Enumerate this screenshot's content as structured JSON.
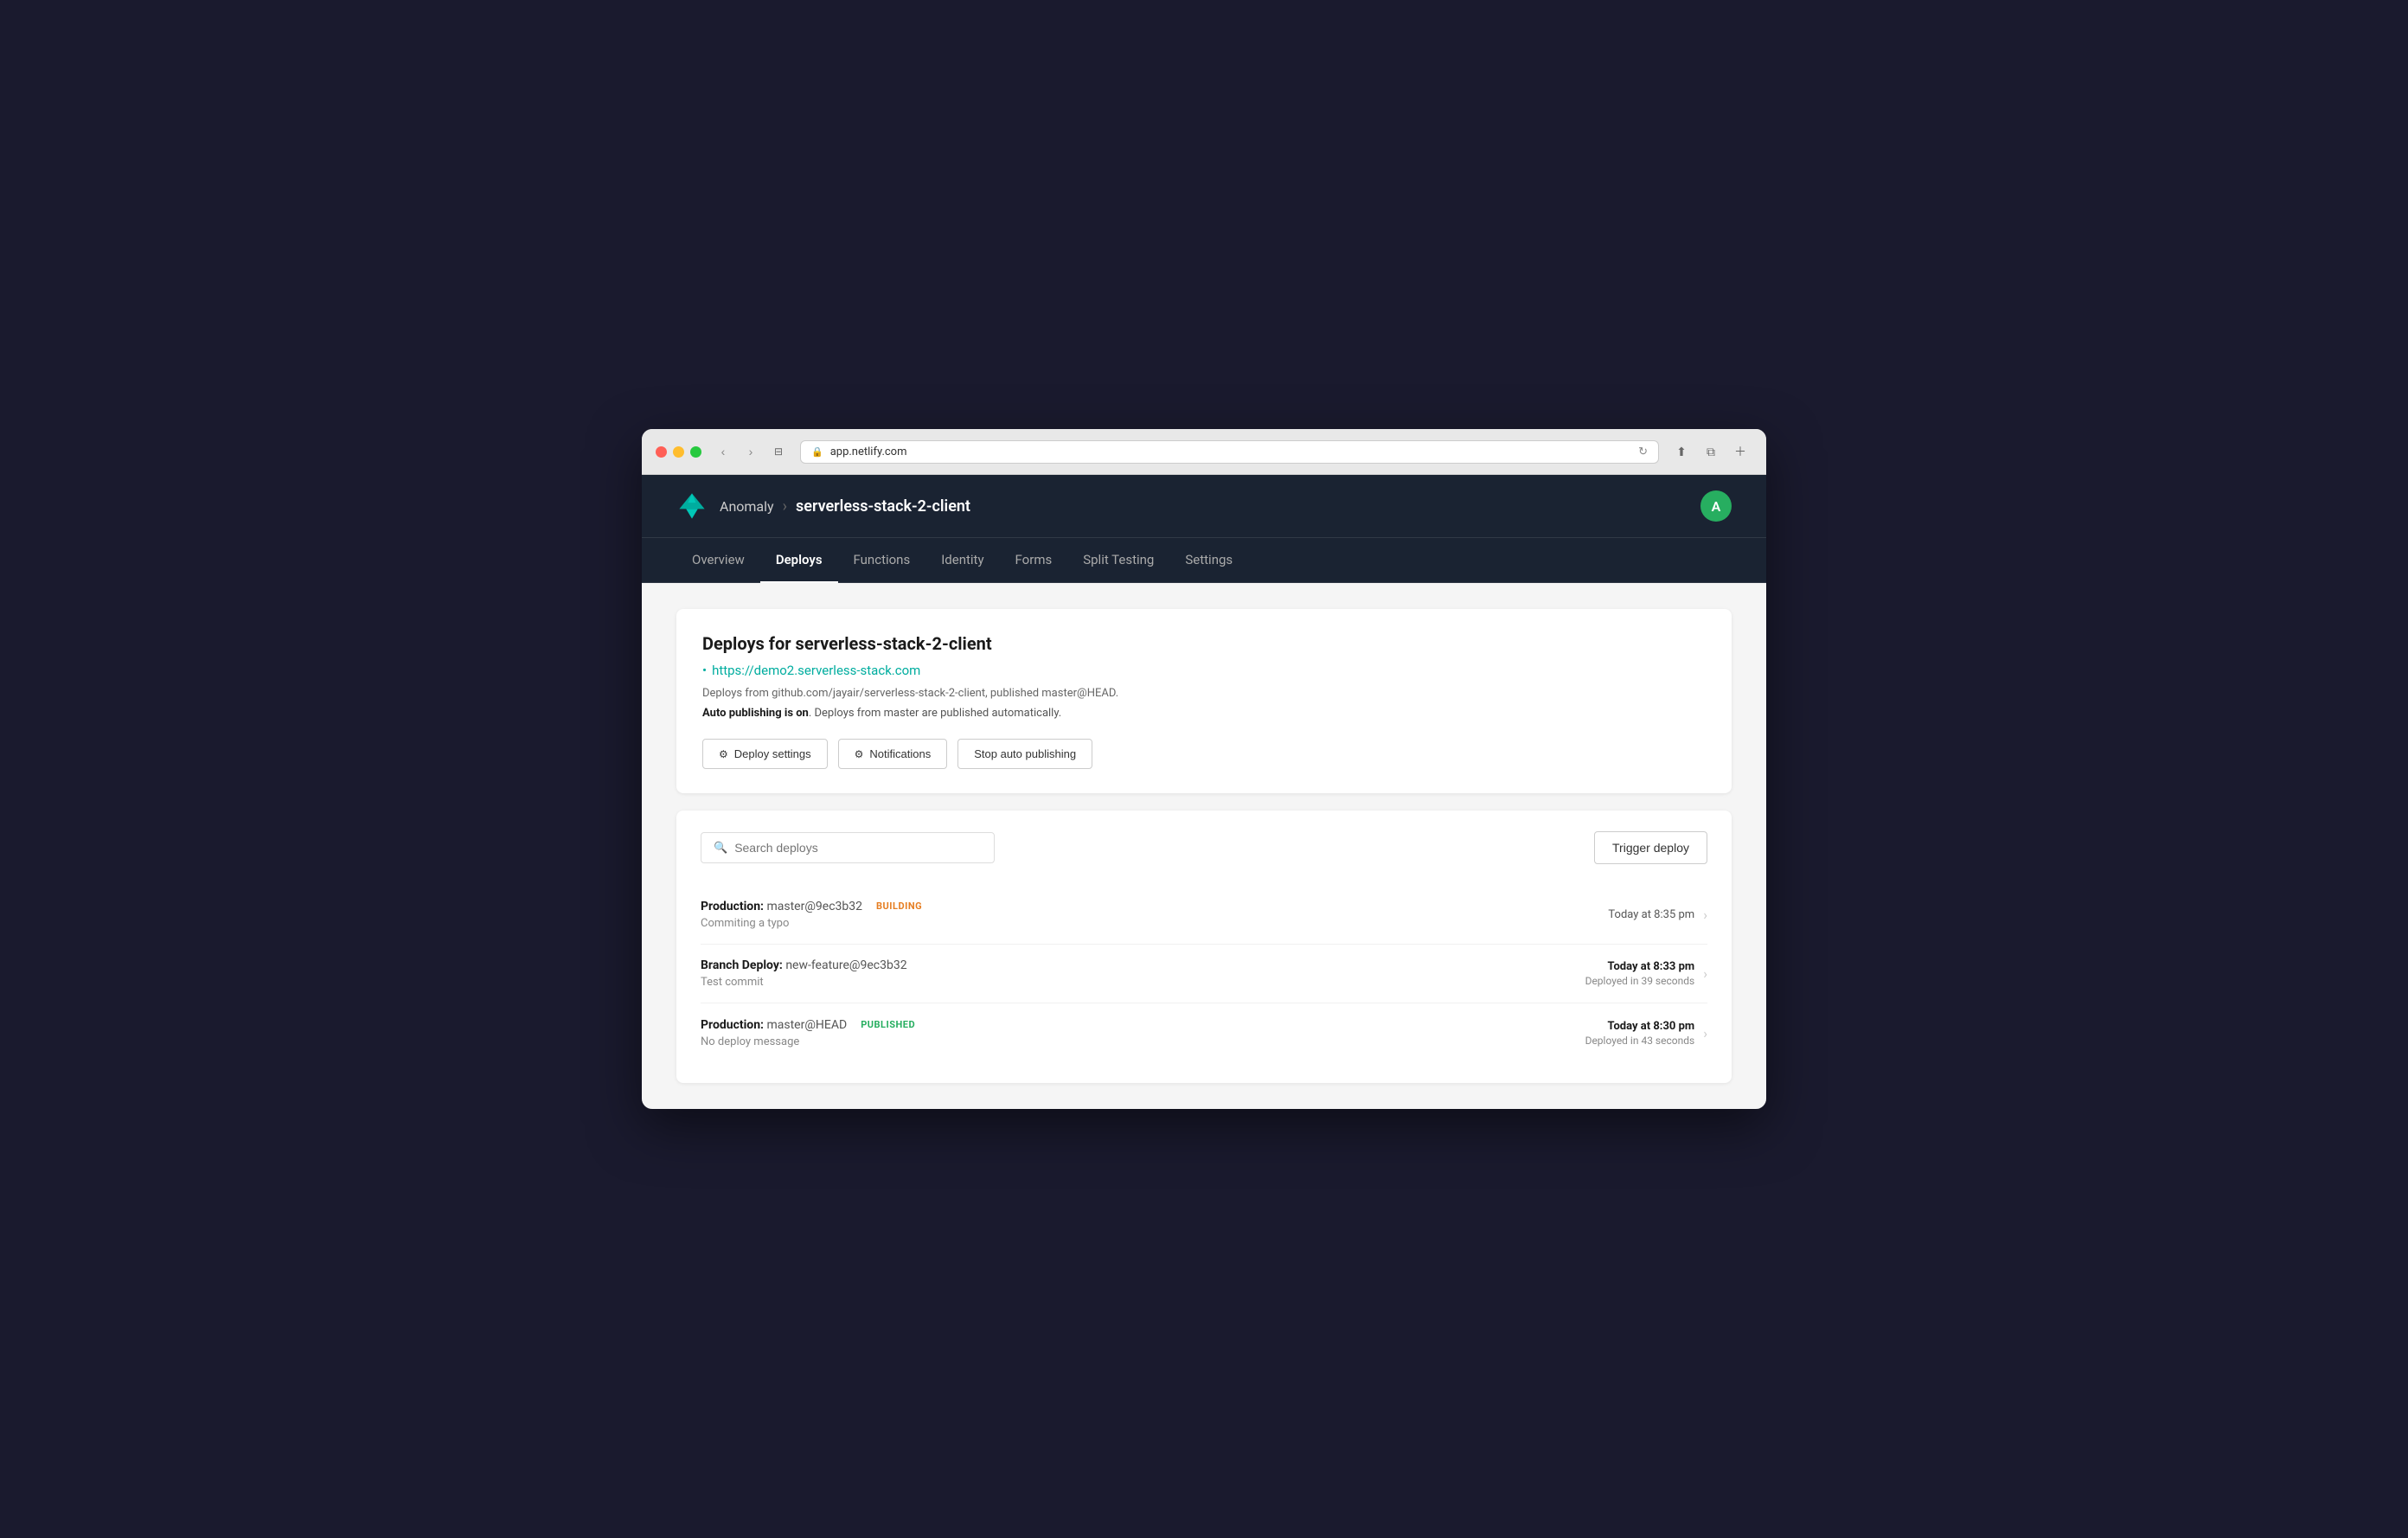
{
  "browser": {
    "url": "app.netlify.com",
    "back_label": "‹",
    "forward_label": "›"
  },
  "header": {
    "team_name": "Anomaly",
    "separator": "›",
    "site_name": "serverless-stack-2-client",
    "avatar_letter": "A"
  },
  "nav": {
    "items": [
      {
        "label": "Overview",
        "active": false
      },
      {
        "label": "Deploys",
        "active": true
      },
      {
        "label": "Functions",
        "active": false
      },
      {
        "label": "Identity",
        "active": false
      },
      {
        "label": "Forms",
        "active": false
      },
      {
        "label": "Split Testing",
        "active": false
      },
      {
        "label": "Settings",
        "active": false
      }
    ]
  },
  "deploys_card": {
    "title": "Deploys for serverless-stack-2-client",
    "site_url": "https://demo2.serverless-stack.com",
    "source_text": "Deploys from github.com/jayair/serverless-stack-2-client, published master@HEAD.",
    "auto_publish_label_bold": "Auto publishing is on",
    "auto_publish_label_rest": ". Deploys from master are published automatically.",
    "btn_deploy_settings": "Deploy settings",
    "btn_notifications": "Notifications",
    "btn_stop_auto": "Stop auto publishing"
  },
  "search": {
    "placeholder": "Search deploys",
    "trigger_btn": "Trigger deploy"
  },
  "deploys": [
    {
      "type_label": "Production:",
      "ref": "master@9ec3b32",
      "badge": "BUILDING",
      "badge_type": "building",
      "message": "Commiting a typo",
      "time": "Today at 8:35 pm",
      "time_bold": false,
      "duration": ""
    },
    {
      "type_label": "Branch Deploy:",
      "ref": "new-feature@9ec3b32",
      "badge": "",
      "badge_type": "",
      "message": "Test commit",
      "time": "Today at 8:33 pm",
      "time_bold": true,
      "duration": "Deployed in 39 seconds"
    },
    {
      "type_label": "Production:",
      "ref": "master@HEAD",
      "badge": "PUBLISHED",
      "badge_type": "published",
      "message": "No deploy message",
      "time": "Today at 8:30 pm",
      "time_bold": true,
      "duration": "Deployed in 43 seconds"
    }
  ]
}
